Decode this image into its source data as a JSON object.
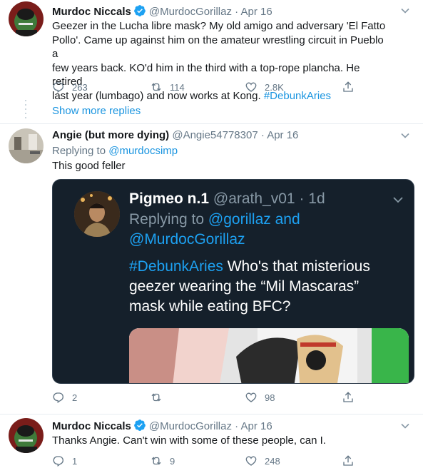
{
  "tweet1": {
    "name": "Murdoc Niccals",
    "handle": "@MurdocGorillaz",
    "date": "· Apr 16",
    "text_lines": [
      "Geezer in the Lucha libre mask? My old amigo and adversary 'El Fatto",
      "Pollo'. Came up against him on the amateur wrestling circuit in Pueblo a",
      "few years back. KO'd him in the third with a top-rope plancha. He retired"
    ],
    "text_last": "last year (lumbago) and now works at Kong. ",
    "hashtag": "#DebunkAries",
    "replies": "263",
    "retweets": "114",
    "likes": "2.8K"
  },
  "show_more": "Show more replies",
  "tweet2": {
    "name": "Angie (but more dying)",
    "handle": "@Angie54778307",
    "date": "· Apr 16",
    "replying_prefix": "Replying to ",
    "replying_handle": "@murdocsimp",
    "text": "This good feller",
    "replies": "2",
    "retweets": "",
    "likes": "98",
    "quoted": {
      "name": "Pigmeo n.1",
      "handle": "@arath_v01",
      "date": "· 1d",
      "replying_prefix": "Replying to ",
      "replying_handle1": "@gorillaz",
      "replying_and": " and",
      "replying_handle2": "@MurdocGorillaz",
      "hashtag": "#DebunkAries",
      "text1": " Who's that misterious",
      "text2": "geezer wearing the “Mil Mascaras”",
      "text3": "mask while eating BFC?"
    }
  },
  "tweet3": {
    "name": "Murdoc Niccals",
    "handle": "@MurdocGorillaz",
    "date": "· Apr 16",
    "text": "Thanks Angie. Can't win with some of these people, can I.",
    "replies": "1",
    "retweets": "9",
    "likes": "248"
  },
  "colors": {
    "link_blue": "#1b95e0",
    "muted": "#657786",
    "card_bg": "#15202b"
  },
  "icons": [
    "verified-badge-icon",
    "chevron-down-icon",
    "reply-icon",
    "retweet-icon",
    "like-icon",
    "share-icon"
  ]
}
